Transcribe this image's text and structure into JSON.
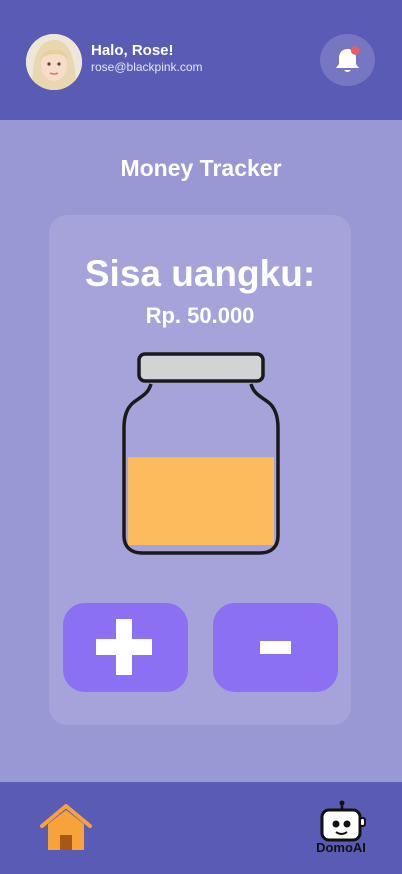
{
  "header": {
    "greeting": "Halo, Rose!",
    "email": "rose@blackpink.com"
  },
  "page": {
    "title": "Money Tracker"
  },
  "balance": {
    "label": "Sisa uangku:",
    "amount": "Rp. 50.000",
    "jar_fill_fraction": 0.52
  },
  "actions": {
    "add_symbol": "+",
    "subtract_symbol": "-"
  },
  "nav": {
    "domo_label": "DomoAI"
  },
  "colors": {
    "header_bg": "#5a5bb4",
    "screen_bg": "#9a98d4",
    "card_bg": "#a5a3da",
    "button_bg": "#8c70f4",
    "jar_fill": "#fcbb5c",
    "notification_dot": "#f05a5a",
    "home_icon": "#f7a23b"
  }
}
